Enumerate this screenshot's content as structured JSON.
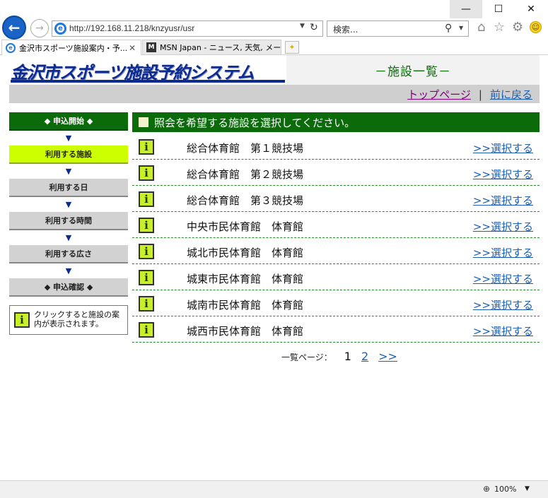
{
  "browser": {
    "window": {
      "minimize": "—",
      "maximize": "☐",
      "close": "✕"
    },
    "nav": {
      "back_icon": "arrow-left-icon",
      "forward_icon": "arrow-right-icon"
    },
    "address": {
      "url": "http://192.168.11.218/knzyusr/usr"
    },
    "search": {
      "placeholder": "検索..."
    },
    "tabs": [
      {
        "label": "金沢市スポーツ施設案内・予...",
        "active": true
      },
      {
        "label": "MSN Japan - ニュース, 天気, メー...",
        "active": false
      }
    ],
    "zoom": "100%"
  },
  "header": {
    "logo_text": "金沢市スポーツ施設予約システム",
    "title": "－施設一覧－"
  },
  "topnav": {
    "top_page": "トップページ",
    "separator": "|",
    "back": "前に戻る"
  },
  "sidebar": {
    "steps": [
      {
        "label": "◆ 申込開始 ◆",
        "state": "start"
      },
      {
        "label": "利用する施設",
        "state": "active"
      },
      {
        "label": "利用する日",
        "state": "normal"
      },
      {
        "label": "利用する時間",
        "state": "normal"
      },
      {
        "label": "利用する広さ",
        "state": "normal"
      },
      {
        "label": "◆ 申込確認 ◆",
        "state": "normal"
      }
    ],
    "arrow": "▼",
    "info_icon_char": "i",
    "info_text": "クリックすると施設の案内が表示されます。"
  },
  "main": {
    "heading": "照会を希望する施設を選択してください。",
    "select_label": ">>選択する",
    "info_icon_char": "i",
    "facilities": [
      "総合体育館　第１競技場",
      "総合体育館　第２競技場",
      "総合体育館　第３競技場",
      "中央市民体育館　体育館",
      "城北市民体育館　体育館",
      "城東市民体育館　体育館",
      "城南市民体育館　体育館",
      "城西市民体育館　体育館"
    ]
  },
  "pager": {
    "label": "一覧ページ：",
    "current": "1",
    "pages": [
      "2"
    ],
    "next": ">>"
  },
  "colors": {
    "brand_green": "#0b6b0b",
    "active_step": "#ccff00",
    "link": "#1b5fb5",
    "visited_link": "#800080",
    "logo_blue": "#0d2b8c"
  }
}
